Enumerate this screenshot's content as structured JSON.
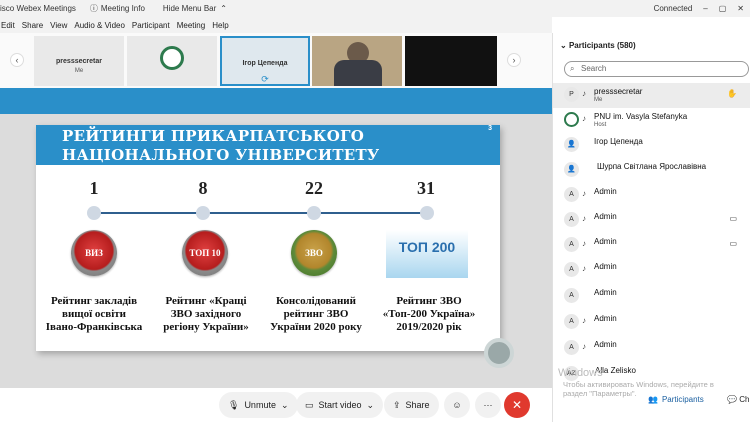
{
  "titlebar": {
    "app_title": "isco Webex Meetings",
    "meeting_info": "Meeting Info",
    "hide_menu": "Hide Menu Bar",
    "status": "Connected"
  },
  "menu": [
    "Edit",
    "Share",
    "View",
    "Audio & Video",
    "Participant",
    "Meeting",
    "Help"
  ],
  "strip": {
    "tiles": [
      {
        "name": "presssecretar",
        "sub": "Me"
      },
      {
        "name": "",
        "sub": ""
      },
      {
        "name": "Ігор Цепенда",
        "sub": ""
      },
      {
        "name": "",
        "sub": ""
      },
      {
        "name": "",
        "sub": ""
      }
    ]
  },
  "slide": {
    "title_line1": "РЕЙТИНГИ ПРИКАРПАТСЬКОГО",
    "title_line2": "НАЦІОНАЛЬНОГО УНІВЕРСИТЕТУ",
    "page_number": "3",
    "items": [
      {
        "rank": "1",
        "badge": "ВИЗ",
        "caption_lines": [
          "Рейтинг закладів",
          "вищої освіти",
          "Івано-Франківська"
        ]
      },
      {
        "rank": "8",
        "badge": "ТОП 10",
        "caption_lines": [
          "Рейтинг «Кращі",
          "ЗВО західного",
          "регіону України»"
        ]
      },
      {
        "rank": "22",
        "badge": "ЗВО",
        "caption_lines": [
          "Консолідований",
          "рейтинг ЗВО",
          "України 2020 року"
        ]
      },
      {
        "rank": "31",
        "badge": "ТОП 200",
        "caption_lines": [
          "Рейтинг ЗВО",
          "«Топ-200 Україна»",
          "2019/2020 рік"
        ]
      }
    ]
  },
  "controls": {
    "unmute": "Unmute",
    "start_video": "Start video",
    "share": "Share"
  },
  "panel": {
    "title": "Participants (580)",
    "search_placeholder": "Search",
    "participants": [
      {
        "initial": "P",
        "name": "presssecretar",
        "sub": "Me"
      },
      {
        "initial": "",
        "name": "PNU im. Vasyla Stefanyka",
        "sub": "Host"
      },
      {
        "initial": "",
        "name": "Ігор Цепенда",
        "sub": ""
      },
      {
        "initial": "",
        "name": "Шурпа Світлана Ярославівна",
        "sub": ""
      },
      {
        "initial": "A",
        "name": "Admin",
        "sub": ""
      },
      {
        "initial": "A",
        "name": "Admin",
        "sub": ""
      },
      {
        "initial": "A",
        "name": "Admin",
        "sub": ""
      },
      {
        "initial": "A",
        "name": "Admin",
        "sub": ""
      },
      {
        "initial": "A",
        "name": "Admin",
        "sub": ""
      },
      {
        "initial": "A",
        "name": "Admin",
        "sub": ""
      },
      {
        "initial": "A",
        "name": "Admin",
        "sub": ""
      },
      {
        "initial": "AZ",
        "name": "Alla Zelisko",
        "sub": ""
      }
    ],
    "footer_participants": "Participants",
    "footer_chat": "Ch"
  },
  "watermark": {
    "line1": "Windows",
    "line2": "Чтобы активировать Windows, перейдите в",
    "line3": "раздел \"Параметры\"."
  }
}
